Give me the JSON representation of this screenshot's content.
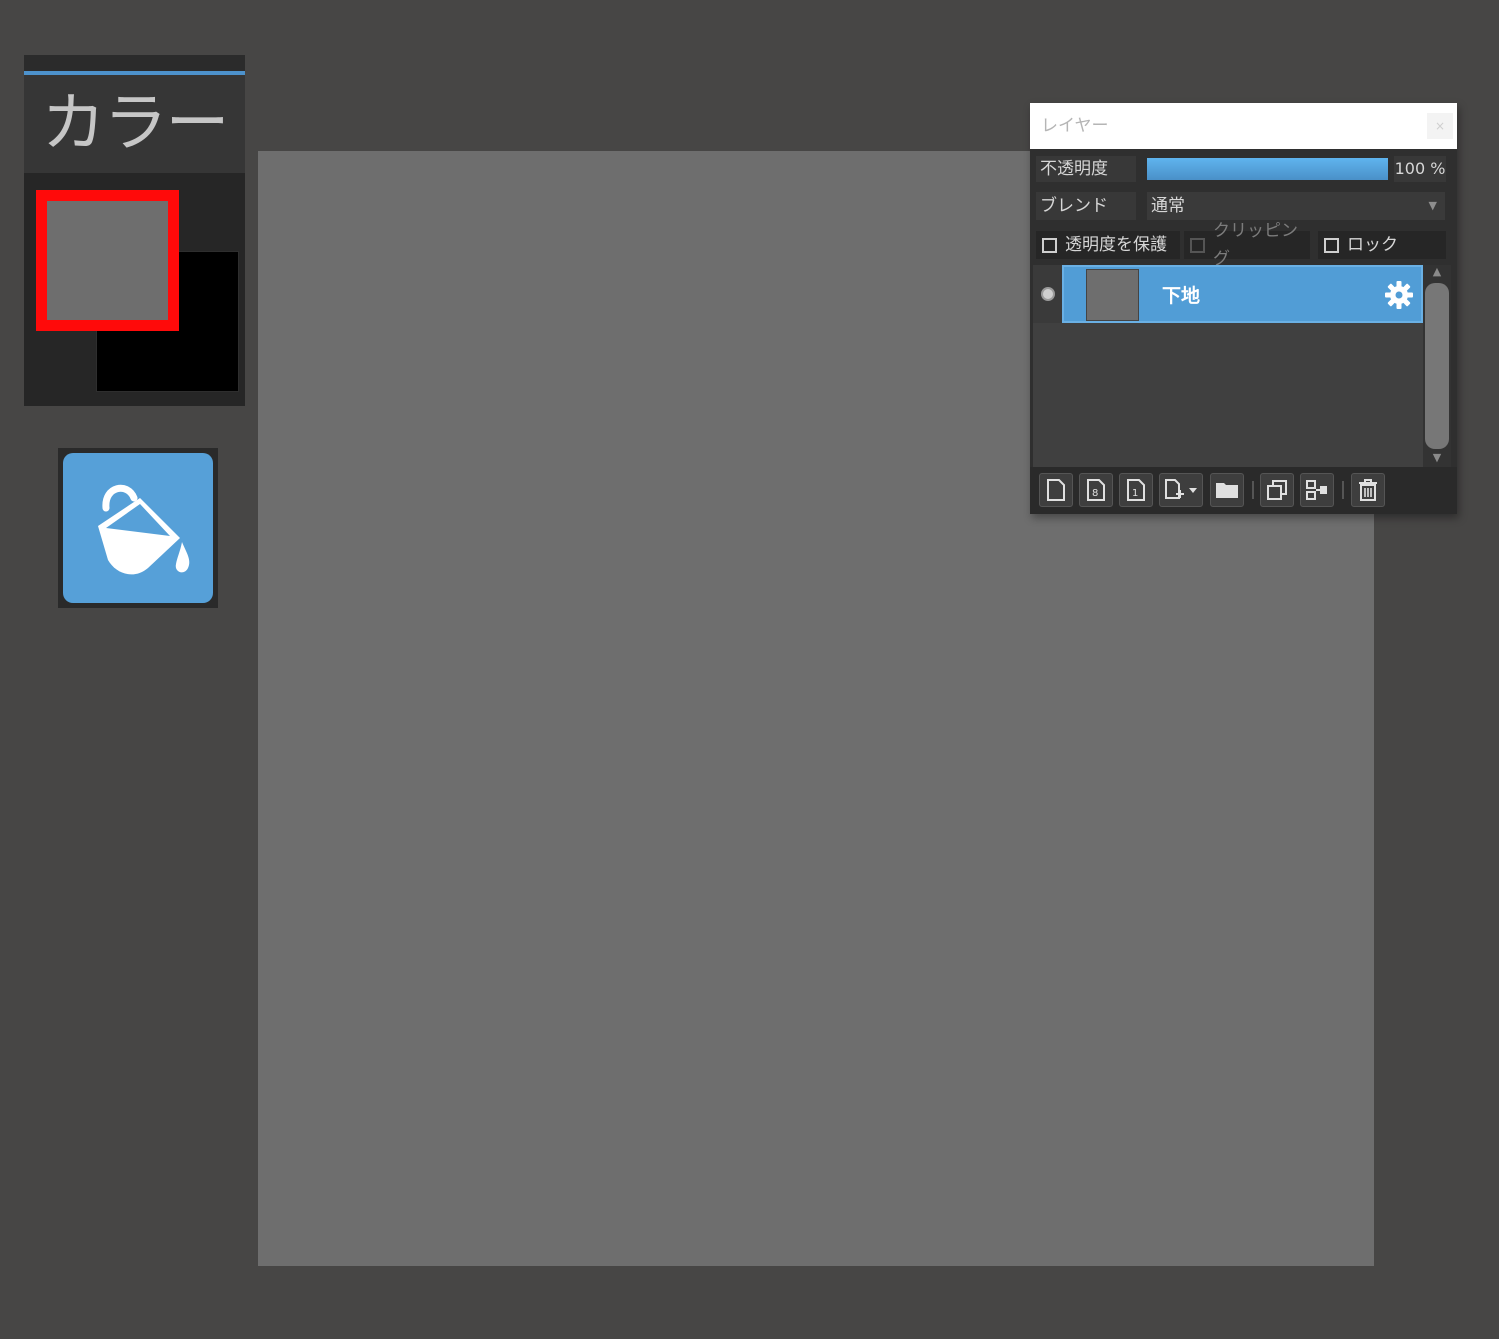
{
  "color_panel": {
    "title": "カラー",
    "foreground_color": "#6e6e6e",
    "background_color": "#000000",
    "active_border_color": "#ff0a0a"
  },
  "tools": {
    "active_tool_icon": "paint-bucket-icon",
    "accent_color": "#56a0d8"
  },
  "canvas": {
    "fill_color": "#6e6e6e"
  },
  "layer_panel": {
    "title": "レイヤー",
    "opacity_label": "不透明度",
    "opacity_value": "100 %",
    "opacity_fraction": 1.0,
    "blend_label": "ブレンド",
    "blend_value": "通常",
    "protect_alpha_label": "透明度を保護",
    "clipping_label": "クリッピング",
    "lock_label": "ロック",
    "layers": [
      {
        "name": "下地",
        "visible": true,
        "selected": true
      }
    ],
    "toolbar_icons": [
      "new-layer-icon",
      "new-8bit-layer-icon",
      "new-1bit-layer-icon",
      "add-layer-dropdown-icon",
      "new-folder-icon",
      "duplicate-layer-icon",
      "merge-layer-icon",
      "delete-layer-icon"
    ]
  }
}
